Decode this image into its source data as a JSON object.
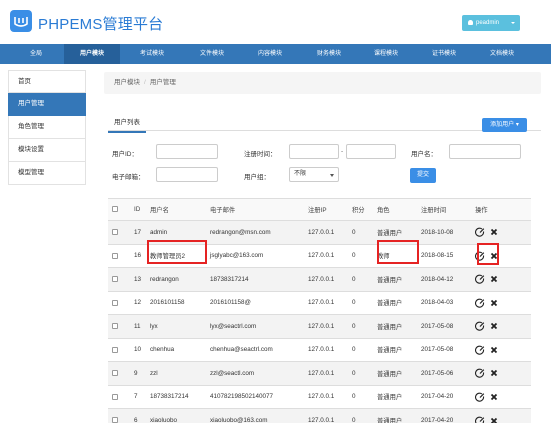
{
  "app": {
    "title": "PHPEMS管理平台",
    "user": "peadmin",
    "colors": {
      "primary": "#3477b8",
      "accent": "#3a8ee6",
      "highlight": "#e52323"
    }
  },
  "nav": [
    "全局",
    "用户模块",
    "考试模块",
    "文件模块",
    "内容模块",
    "财务模块",
    "课程模块",
    "证书模块",
    "文档模块"
  ],
  "nav_active": "用户模块",
  "sidebar": [
    "首页",
    "用户管理",
    "角色管理",
    "模块设置",
    "模型管理"
  ],
  "sidebar_active": "用户管理",
  "breadcrumb": [
    "用户模块",
    "用户管理"
  ],
  "tab": "用户列表",
  "add_button": "添加用户",
  "filters": {
    "uid_label": "用户ID：",
    "regtime_label": "注册时间：",
    "regtime_sep": "-",
    "username_label": "用户名：",
    "email_label": "电子邮箱：",
    "group_label": "用户组：",
    "group_value": "不限",
    "submit": "提交"
  },
  "table": {
    "headers": [
      "",
      "ID",
      "用户名",
      "电子邮件",
      "注册IP",
      "积分",
      "角色",
      "注册时间",
      "操作"
    ],
    "rows": [
      {
        "id": "17",
        "username": "admin",
        "email": "redrangon@msn.com",
        "ip": "127.0.0.1",
        "score": "0",
        "role": "普通用户",
        "regtime": "2018-10-08"
      },
      {
        "id": "16",
        "username": "教师管理员2",
        "email": "jsglyabc@163.com",
        "ip": "127.0.0.1",
        "score": "0",
        "role": "教师",
        "regtime": "2018-08-15"
      },
      {
        "id": "13",
        "username": "redrangon",
        "email": "18738317214",
        "ip": "127.0.0.1",
        "score": "0",
        "role": "普通用户",
        "regtime": "2018-04-12"
      },
      {
        "id": "12",
        "username": "2016101158",
        "email": "2016101158@",
        "ip": "127.0.0.1",
        "score": "0",
        "role": "普通用户",
        "regtime": "2018-04-03"
      },
      {
        "id": "11",
        "username": "lyx",
        "email": "lyx@seactrl.com",
        "ip": "127.0.0.1",
        "score": "0",
        "role": "普通用户",
        "regtime": "2017-05-08"
      },
      {
        "id": "10",
        "username": "chenhua",
        "email": "chenhua@seactrl.com",
        "ip": "127.0.0.1",
        "score": "0",
        "role": "普通用户",
        "regtime": "2017-05-08"
      },
      {
        "id": "9",
        "username": "zzl",
        "email": "zzl@seactl.com",
        "ip": "127.0.0.1",
        "score": "0",
        "role": "普通用户",
        "regtime": "2017-05-06"
      },
      {
        "id": "7",
        "username": "18738317214",
        "email": "410782198502140077",
        "ip": "127.0.0.1",
        "score": "0",
        "role": "普通用户",
        "regtime": "2017-04-20"
      },
      {
        "id": "6",
        "username": "xiaoluobo",
        "email": "xiaoluobo@163.com",
        "ip": "127.0.0.1",
        "score": "0",
        "role": "普通用户",
        "regtime": "2017-04-20"
      }
    ]
  }
}
